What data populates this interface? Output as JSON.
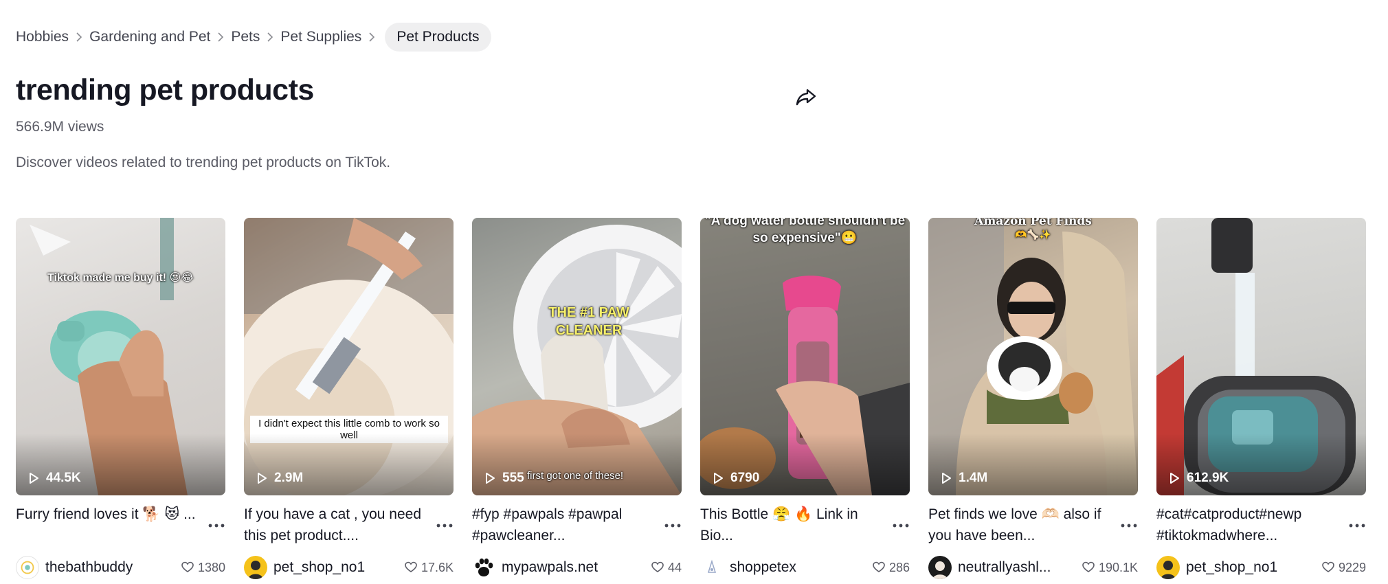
{
  "breadcrumb": {
    "items": [
      "Hobbies",
      "Gardening and Pet",
      "Pets",
      "Pet Supplies"
    ],
    "current": "Pet Products"
  },
  "header": {
    "title": "trending pet products",
    "views": "566.9M views",
    "description": "Discover videos related to trending pet products on TikTok."
  },
  "videos": [
    {
      "plays": "44.5K",
      "caption": "Furry friend loves it 🐕 😻 ...",
      "author": "thebathbuddy",
      "likes": "1380",
      "overlay": "Tiktok made me buy it! 😍😂"
    },
    {
      "plays": "2.9M",
      "caption": "If you have a cat , you need this pet product....",
      "author": "pet_shop_no1",
      "likes": "17.6K",
      "overlay": "I didn't expect this little comb to work so well"
    },
    {
      "plays": "555",
      "caption": "#fyp #pawpals #pawpal #pawcleaner...",
      "author": "mypawpals.net",
      "likes": "44",
      "overlay": "THE #1 PAW CLEANER",
      "overlay2": "first got one of these!"
    },
    {
      "plays": "6790",
      "caption": "This Bottle 😤 🔥 Link in Bio...",
      "author": "shoppetex",
      "likes": "286",
      "overlay": "\"A dog water bottle shouldn't be so expensive\"😬"
    },
    {
      "plays": "1.4M",
      "caption": "Pet finds we love 🫶🏻 also if you have been...",
      "author": "neutrallyashl...",
      "likes": "190.1K",
      "overlay": "Amazon Pet Finds",
      "overlay2": "🫶🦴✨"
    },
    {
      "plays": "612.9K",
      "caption": "#cat#catproduct#newp #tiktokmadwhere...",
      "author": "pet_shop_no1",
      "likes": "9229"
    }
  ],
  "colors": {
    "text": "#161823",
    "secondary": "#5b5c66",
    "chip": "#efeff0"
  }
}
